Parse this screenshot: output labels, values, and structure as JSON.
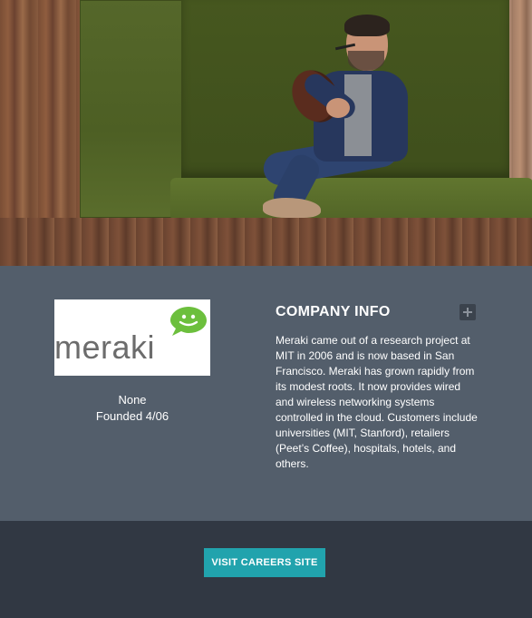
{
  "hero": {
    "image_alt": "person-sitting-in-booth-with-football"
  },
  "company": {
    "logo": {
      "word": "meraki",
      "icon": "speech-bubble-smile-icon",
      "brand_color": "#6cbf3d"
    },
    "name": "None",
    "founded": "Founded 4/06"
  },
  "company_info": {
    "title": "COMPANY INFO",
    "expand_icon": "plus-icon",
    "description": "Meraki came out of a research project at MIT in 2006 and is now based in San Francisco. Meraki has grown rapidly from its modest roots. It now provides wired and wireless networking systems controlled in the cloud. Customers include universities (MIT, Stanford), retailers (Peet’s Coffee), hospitals, hotels, and others."
  },
  "footer": {
    "careers_button_label": "VISIT CAREERS SITE",
    "button_color": "#21a3ad"
  },
  "colors": {
    "info_panel": "#535e6b",
    "footer": "#313843"
  }
}
